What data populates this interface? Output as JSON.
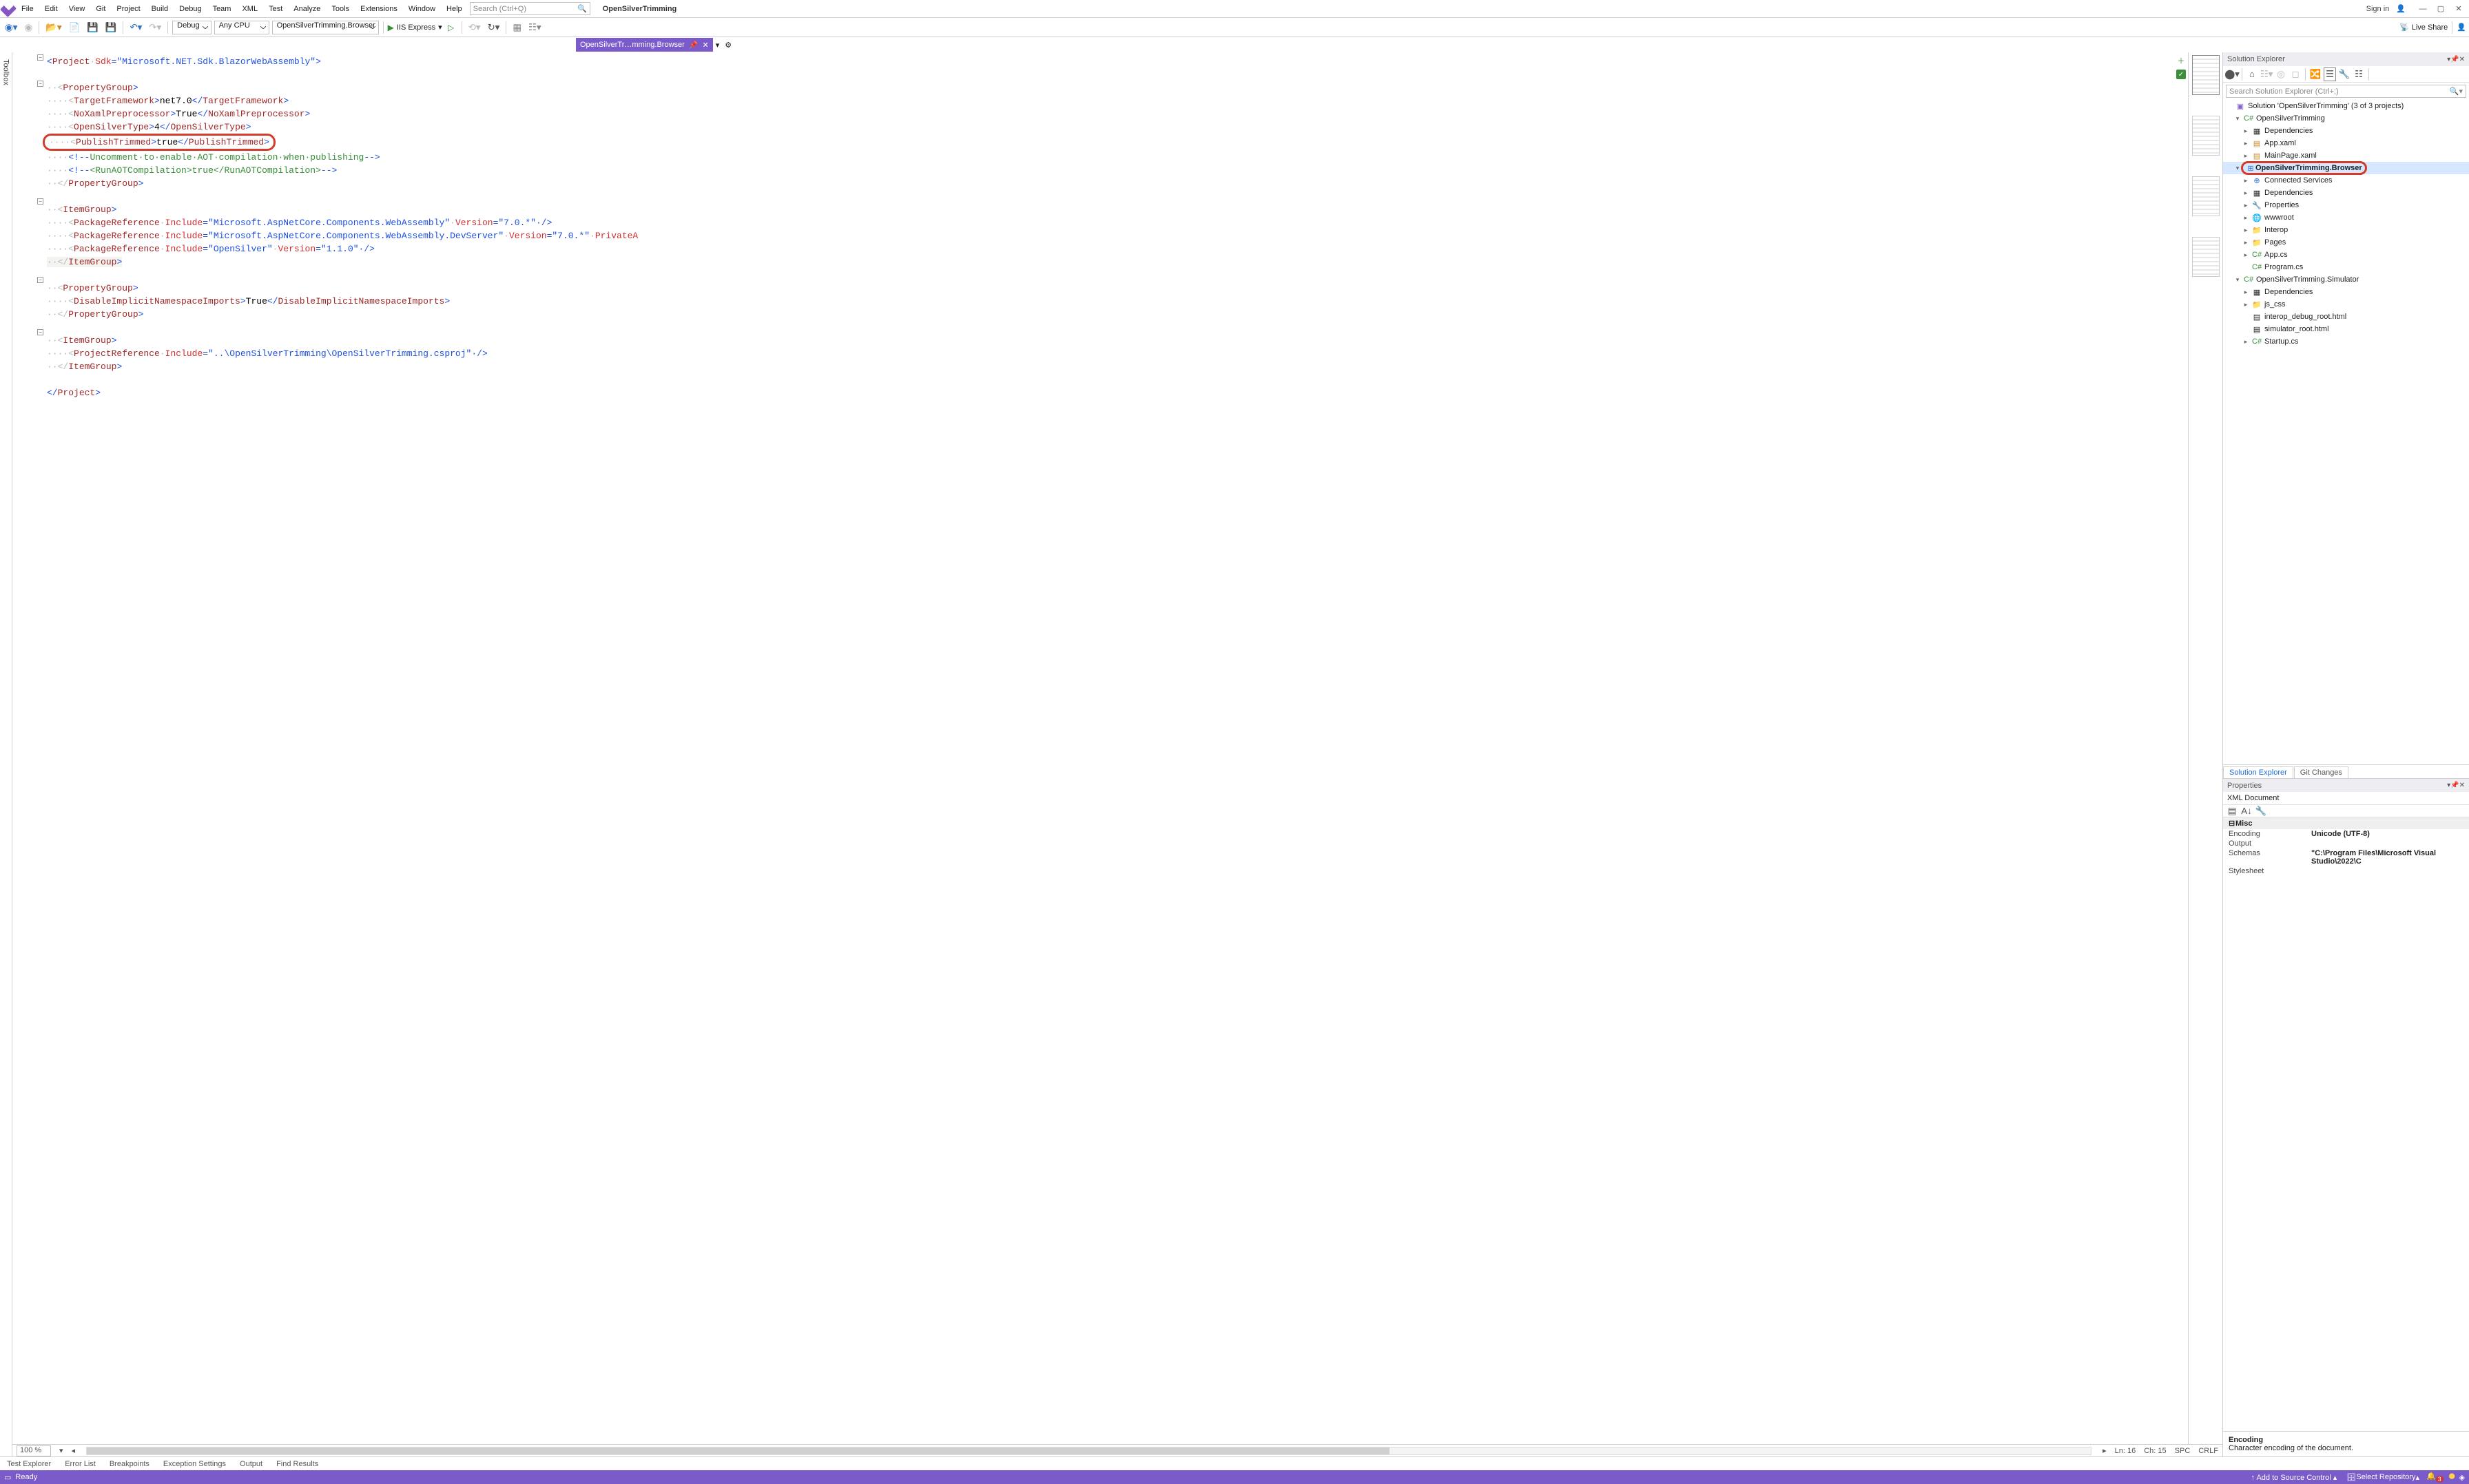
{
  "menus": [
    "File",
    "Edit",
    "View",
    "Git",
    "Project",
    "Build",
    "Debug",
    "Team",
    "XML",
    "Test",
    "Analyze",
    "Tools",
    "Extensions",
    "Window",
    "Help"
  ],
  "search_placeholder": "Search (Ctrl+Q)",
  "solution_title": "OpenSilverTrimming",
  "signin": "Sign in",
  "toolbar": {
    "config": "Debug",
    "platform": "Any CPU",
    "startup": "OpenSilverTrimming.Browser",
    "run": "IIS Express",
    "liveshare": "Live Share"
  },
  "doc_tab": {
    "label": "OpenSilverTr…mming.Browser"
  },
  "code": {
    "l1a": "<",
    "l1b": "Project",
    "l1sp": "·",
    "l1c": "Sdk",
    "l1d": "=",
    "l1e": "\"Microsoft.NET.Sdk.BlazorWebAssembly\"",
    "l1f": ">",
    "l3a": "··<",
    "l3b": "PropertyGroup",
    "l3c": ">",
    "l4a": "····<",
    "l4b": "TargetFramework",
    "l4c": ">",
    "l4d": "net7.0",
    "l4e": "</",
    "l4f": "TargetFramework",
    "l4g": ">",
    "l5a": "····<",
    "l5b": "NoXamlPreprocessor",
    "l5c": ">",
    "l5d": "True",
    "l5e": "</",
    "l5f": "NoXamlPreprocessor",
    "l5g": ">",
    "l6a": "····<",
    "l6b": "OpenSilverType",
    "l6c": ">",
    "l6d": "4",
    "l6e": "</",
    "l6f": "OpenSilverType",
    "l6g": ">",
    "l7a": "····<",
    "l7b": "PublishTrimmed",
    "l7c": ">",
    "l7d": "true",
    "l7e": "</",
    "l7f": "PublishTrimmed",
    "l7g": ">",
    "l8a": "····",
    "l8b": "<!--",
    "l8c": "Uncomment·to·enable·AOT·compilation·when·publishing",
    "l8d": "-->",
    "l9a": "····",
    "l9b": "<!--",
    "l9c": "<RunAOTCompilation>true</RunAOTCompilation>",
    "l9d": "-->",
    "l10a": "··</",
    "l10b": "PropertyGroup",
    "l10c": ">",
    "l12a": "··<",
    "l12b": "ItemGroup",
    "l12c": ">",
    "l13a": "····<",
    "l13b": "PackageReference",
    "l13c": "·",
    "l13d": "Include",
    "l13e": "=",
    "l13f": "\"Microsoft.AspNetCore.Components.WebAssembly\"",
    "l13g": "·",
    "l13h": "Version",
    "l13i": "=",
    "l13j": "\"7.0.*\"",
    "l13k": "·/>",
    "l14a": "····<",
    "l14b": "PackageReference",
    "l14d": "Include",
    "l14f": "\"Microsoft.AspNetCore.Components.WebAssembly.DevServer\"",
    "l14h": "Version",
    "l14j": "\"7.0.*\"",
    "l14p": "PrivateA",
    "l15a": "····<",
    "l15b": "PackageReference",
    "l15d": "Include",
    "l15f": "\"OpenSilver\"",
    "l15h": "Version",
    "l15j": "\"1.1.0\"",
    "l15k": "·/>",
    "l16a": "··</",
    "l16b": "ItemGroup",
    "l16c": ">",
    "l18a": "··<",
    "l18b": "PropertyGroup",
    "l18c": ">",
    "l19a": "····<",
    "l19b": "DisableImplicitNamespaceImports",
    "l19c": ">",
    "l19d": "True",
    "l19e": "</",
    "l19f": "DisableImplicitNamespaceImports",
    "l19g": ">",
    "l20a": "··</",
    "l20b": "PropertyGroup",
    "l20c": ">",
    "l22a": "··<",
    "l22b": "ItemGroup",
    "l22c": ">",
    "l23a": "····<",
    "l23b": "ProjectReference",
    "l23d": "Include",
    "l23f": "\"..\\OpenSilverTrimming\\OpenSilverTrimming.csproj\"",
    "l23k": "·/>",
    "l24a": "··</",
    "l24b": "ItemGroup",
    "l24c": ">",
    "l26a": "</",
    "l26b": "Project",
    "l26c": ">"
  },
  "editor_status": {
    "zoom": "100 %",
    "ln": "Ln: 16",
    "ch": "Ch: 15",
    "spc": "SPC",
    "crlf": "CRLF"
  },
  "bottom_tabs": [
    "Test Explorer",
    "Error List",
    "Breakpoints",
    "Exception Settings",
    "Output",
    "Find Results"
  ],
  "status": {
    "ready": "Ready",
    "add_src": "Add to Source Control",
    "select_repo": "Select Repository",
    "badge": "3"
  },
  "se": {
    "title": "Solution Explorer",
    "search": "Search Solution Explorer (Ctrl+;)",
    "sln": "Solution 'OpenSilverTrimming' (3 of 3 projects)",
    "p1": "OpenSilverTrimming",
    "p1_dep": "Dependencies",
    "p1_app": "App.xaml",
    "p1_main": "MainPage.xaml",
    "p2": "OpenSilverTrimming.Browser",
    "p2_cs": "Connected Services",
    "p2_dep": "Dependencies",
    "p2_prop": "Properties",
    "p2_www": "wwwroot",
    "p2_interop": "Interop",
    "p2_pages": "Pages",
    "p2_app": "App.cs",
    "p2_prog": "Program.cs",
    "p3": "OpenSilverTrimming.Simulator",
    "p3_dep": "Dependencies",
    "p3_js": "js_css",
    "p3_idbg": "interop_debug_root.html",
    "p3_sroot": "simulator_root.html",
    "p3_start": "Startup.cs",
    "tab_se": "Solution Explorer",
    "tab_git": "Git Changes"
  },
  "props": {
    "title": "Properties",
    "doc": "XML Document",
    "cat": "Misc",
    "rows": [
      {
        "k": "Encoding",
        "v": "Unicode (UTF-8)"
      },
      {
        "k": "Output",
        "v": ""
      },
      {
        "k": "Schemas",
        "v": "\"C:\\Program Files\\Microsoft Visual Studio\\2022\\C"
      },
      {
        "k": "Stylesheet",
        "v": ""
      }
    ],
    "desc_t": "Encoding",
    "desc_b": "Character encoding of the document."
  },
  "toolbox": "Toolbox"
}
